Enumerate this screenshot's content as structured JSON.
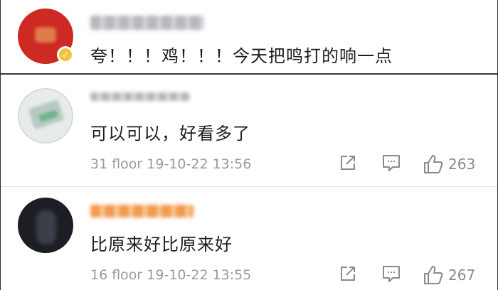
{
  "comments": [
    {
      "username": "",
      "text": "夸！！！鸡！！！今天把鸣打的响一点",
      "verified": true
    },
    {
      "username": "",
      "text": "可以可以，好看多了",
      "floor": "31 floor",
      "datetime": "19-10-22 13:56",
      "likes": "263"
    },
    {
      "username": "",
      "text": "比原来好比原来好",
      "floor": "16 floor",
      "datetime": "19-10-22 13:55",
      "likes": "267"
    }
  ],
  "icons": {
    "share": "share-icon",
    "comment": "comment-icon",
    "like": "thumbs-up-icon"
  },
  "colors": {
    "text": "#1e1e1e",
    "meta": "#9a9a9a",
    "icon": "#8a8a8a"
  }
}
